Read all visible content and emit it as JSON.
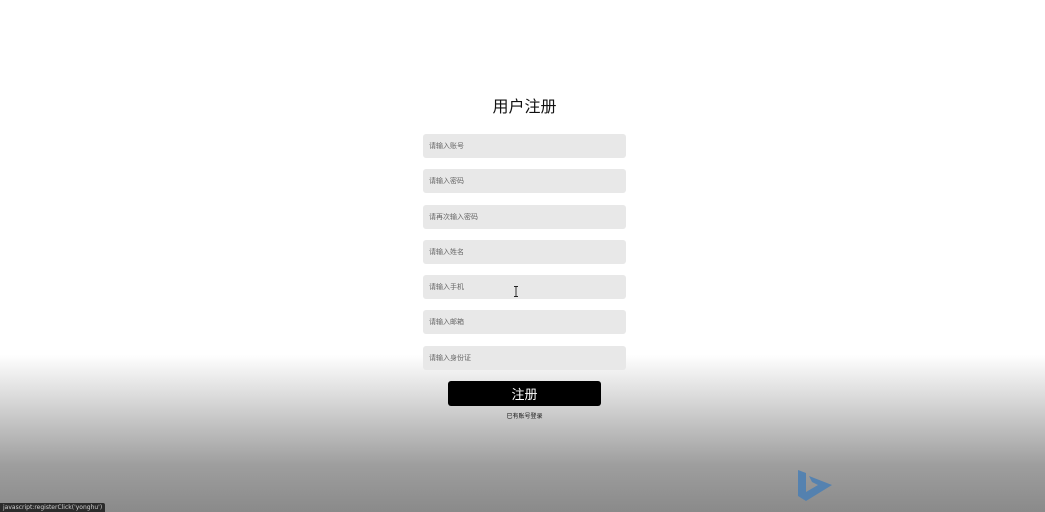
{
  "form": {
    "title": "用户注册",
    "fields": {
      "account": {
        "placeholder": "请输入账号"
      },
      "password": {
        "placeholder": "请输入密码"
      },
      "password_confirm": {
        "placeholder": "请再次输入密码"
      },
      "name": {
        "placeholder": "请输入姓名"
      },
      "phone": {
        "placeholder": "请输入手机"
      },
      "email": {
        "placeholder": "请输入邮箱"
      },
      "id_card": {
        "placeholder": "请输入身份证"
      }
    },
    "submit_label": "注册",
    "login_link": "已有账号登录"
  },
  "statusbar": {
    "text": "javascript:registerClick('yonghu')"
  },
  "icons": {
    "cursor": "text-cursor-icon",
    "logo": "bing-logo-icon"
  },
  "colors": {
    "field_bg": "#e8e8e8",
    "button_bg": "#000000",
    "logo": "#4a7fb5"
  }
}
